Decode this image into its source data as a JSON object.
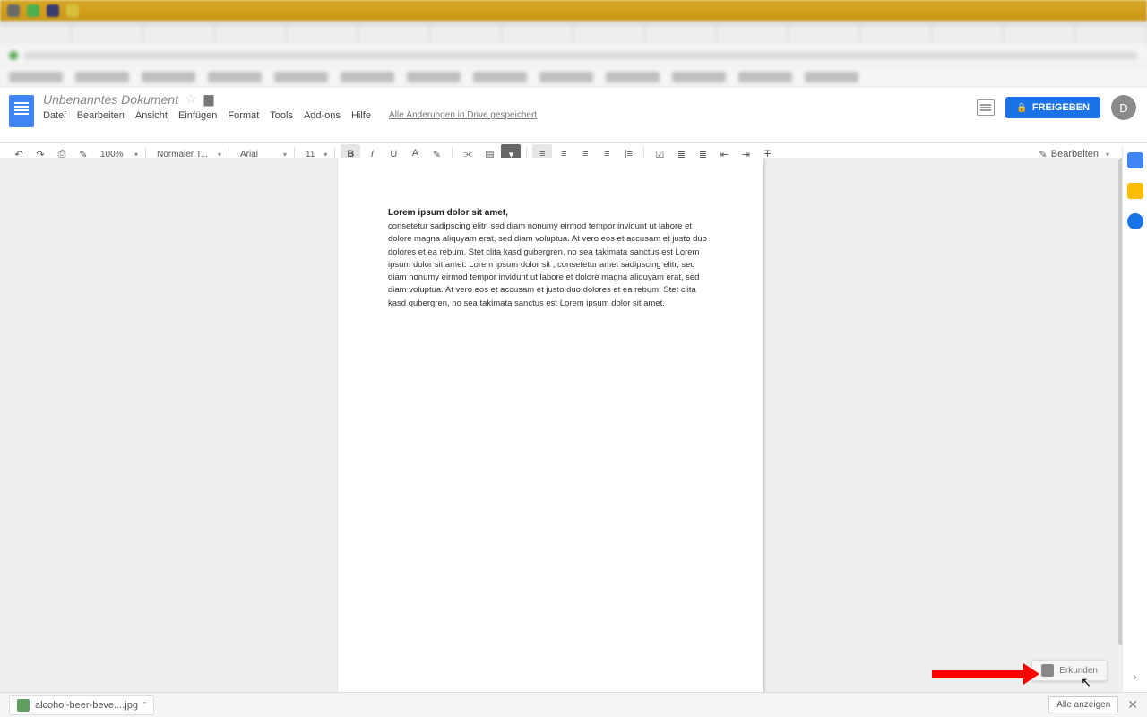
{
  "doc": {
    "title": "Unbenanntes Dokument",
    "save_status": "Alle Änderungen in Drive gespeichert"
  },
  "menu": {
    "file": "Datei",
    "edit": "Bearbeiten",
    "view": "Ansicht",
    "insert": "Einfügen",
    "format": "Format",
    "tools": "Tools",
    "addons": "Add-ons",
    "help": "Hilfe"
  },
  "share": {
    "label": "FREIGEBEN"
  },
  "avatar": {
    "initial": "D"
  },
  "toolbar": {
    "zoom": "100%",
    "style": "Normaler T...",
    "font": "Arial",
    "size": "11",
    "edit_label": "Bearbeiten"
  },
  "document_body": {
    "heading": "Lorem ipsum dolor sit amet,",
    "paragraph": "consetetur sadipscing elitr, sed diam nonumy eirmod tempor invidunt ut labore et dolore magna aliquyam erat, sed diam voluptua. At vero eos et accusam et justo duo dolores et ea rebum. Stet clita kasd gubergren, no sea takimata sanctus est Lorem ipsum dolor sit amet. Lorem ipsum dolor sit , consetetur amet sadipscing elitr, sed diam nonumy eirmod tempor invidunt ut labore et dolore magna aliquyam erat, sed diam voluptua. At vero eos et accusam et justo duo dolores et ea rebum. Stet clita kasd gubergren, no sea takimata sanctus est Lorem ipsum dolor sit amet."
  },
  "explore": {
    "label": "Erkunden"
  },
  "download": {
    "file": "alcohol-beer-beve....jpg",
    "show_all": "Alle anzeigen"
  },
  "side": {
    "cal_color": "#4285f4",
    "keep_color": "#fbbc04",
    "tasks_color": "#1a73e8"
  }
}
